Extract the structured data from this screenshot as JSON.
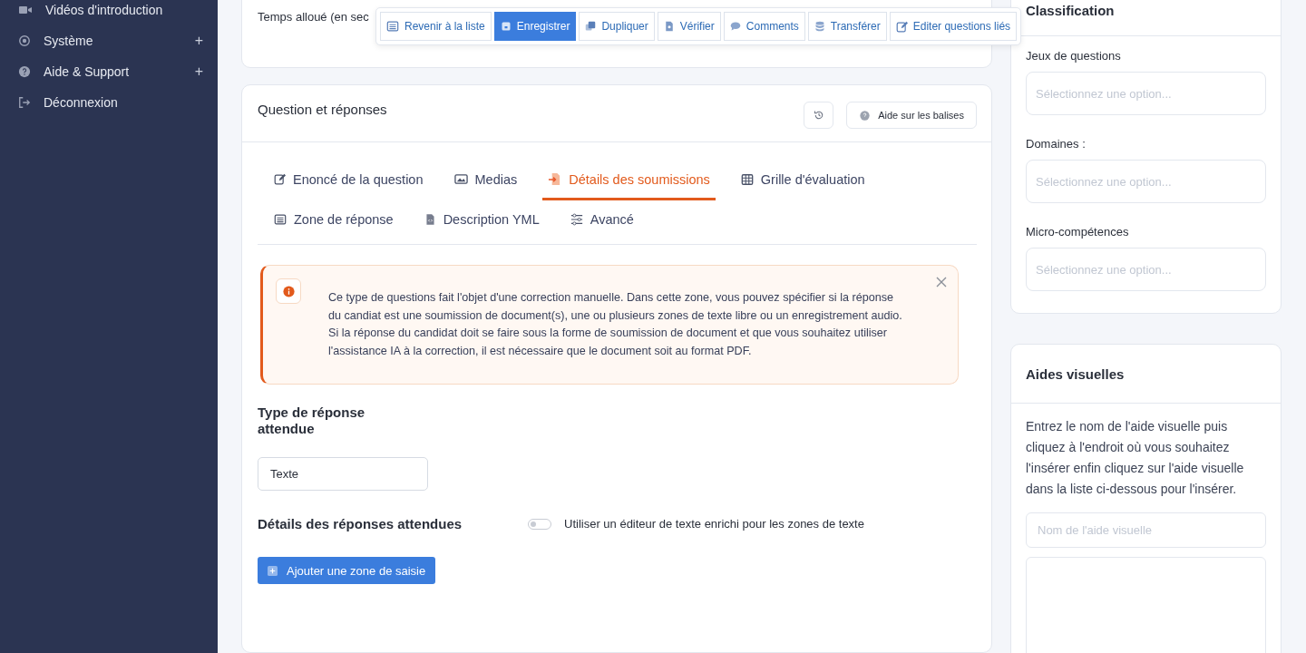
{
  "sidebar": {
    "items": [
      {
        "label": "Vidéos d'introduction"
      },
      {
        "label": "Système",
        "expander": "+"
      },
      {
        "label": "Aide & Support",
        "expander": "+"
      },
      {
        "label": "Déconnexion"
      }
    ]
  },
  "top_card": {
    "field_label": "Temps alloué (en sec"
  },
  "toolbar": [
    {
      "label": "Revenir à la liste",
      "kind": "default"
    },
    {
      "label": "Enregistrer",
      "kind": "primary"
    },
    {
      "label": "Dupliquer",
      "kind": "default"
    },
    {
      "label": "Vérifier",
      "kind": "default"
    },
    {
      "label": "Comments",
      "kind": "default"
    },
    {
      "label": "Transférer",
      "kind": "default"
    },
    {
      "label": "Editer questions liés",
      "kind": "default"
    }
  ],
  "question_card": {
    "title": "Question et réponses",
    "help_button": "Aide sur les balises",
    "tabs": [
      [
        {
          "label": "Enoncé de la question",
          "selected": false
        },
        {
          "label": "Medias",
          "selected": false
        },
        {
          "label": "Détails des soumissions",
          "selected": true
        },
        {
          "label": "Grille d'évaluation",
          "selected": false
        }
      ],
      [
        {
          "label": "Zone de réponse",
          "selected": false
        },
        {
          "label": "Description YML",
          "selected": false
        },
        {
          "label": "Avancé",
          "selected": false
        }
      ]
    ],
    "alert": "Ce type de questions fait l'objet d'une correction manuelle. Dans cette zone, vous pouvez spécifier si la réponse du candiat est une soumission de document(s), une ou plusieurs zones de texte libre ou un enregistrement audio. Si la réponse du candidat doit se faire sous la forme de soumission de document et que vous souhaitez utiliser l'assistance IA à la correction, il est nécessaire que le document soit au format PDF.",
    "response_type_label": "Type de réponse attendue",
    "response_type_value": "Texte",
    "details_label": "Détails des réponses attendues",
    "rich_editor_toggle": {
      "label": "Utiliser un éditeur de texte enrichi pour les zones de texte",
      "on": false
    },
    "add_button": "Ajouter une zone de saisie"
  },
  "classification": {
    "title": "Classification",
    "fields": [
      {
        "label": "Jeux de questions",
        "placeholder": "Sélectionnez une option..."
      },
      {
        "label": "Domaines :",
        "placeholder": "Sélectionnez une option..."
      },
      {
        "label": "Micro-compétences",
        "placeholder": "Sélectionnez une option..."
      }
    ]
  },
  "visual_aids": {
    "title": "Aides visuelles",
    "instructions": "Entrez le nom de l'aide visuelle puis cliquez à l'endroit où vous souhaitez l'insérer enfin cliquez sur l'aide visuelle dans la liste ci-dessous pour l'insérer.",
    "name_placeholder": "Nom de l'aide visuelle"
  }
}
